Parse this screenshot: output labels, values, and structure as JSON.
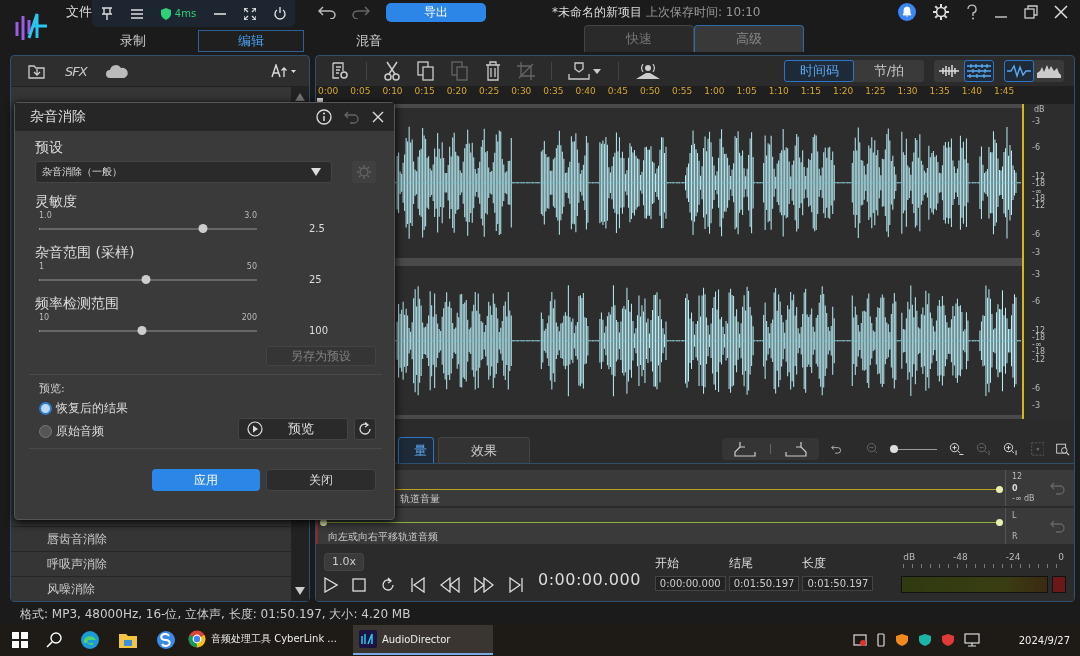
{
  "app": {
    "menu": "文件",
    "export": "导出",
    "title": "*未命名的新项目",
    "save_info": "上次保存时间: 10:10"
  },
  "overlay": {
    "latency": "4ms"
  },
  "mode_tabs": [
    {
      "label": "录制",
      "selected": false
    },
    {
      "label": "编辑",
      "selected": true
    },
    {
      "label": "混音",
      "selected": false
    }
  ],
  "view_tabs": [
    {
      "label": "快速",
      "selected": false
    },
    {
      "label": "高级",
      "selected": true
    }
  ],
  "left_panel": {
    "sfx": "SFX",
    "items": [
      "唇齿音消除",
      "呼吸声消除",
      "风噪消除"
    ]
  },
  "dialog": {
    "title": "杂音消除",
    "preset_label": "预设",
    "preset": "杂音消除（一般）",
    "sliders": [
      {
        "label": "灵敏度",
        "min": "1.0",
        "max": "3.0",
        "value": "2.5",
        "level": 0.75
      },
      {
        "label": "杂音范围 (采样)",
        "min": "1",
        "max": "50",
        "value": "25",
        "level": 0.49
      },
      {
        "label": "频率检测范围",
        "min": "10",
        "max": "200",
        "value": "100",
        "level": 0.47
      }
    ],
    "save_preset": "另存为预设",
    "preview_label": "预览:",
    "options": [
      {
        "label": "恢复后的结果",
        "selected": true
      },
      {
        "label": "原始音频",
        "selected": false
      }
    ],
    "preview_button": "预览",
    "apply": "应用",
    "close": "关闭"
  },
  "editor": {
    "time_modes": [
      {
        "label": "时间码",
        "selected": true
      },
      {
        "label": "节/拍",
        "selected": false
      }
    ],
    "ruler": [
      "0:00",
      "0:05",
      "0:10",
      "0:15",
      "0:20",
      "0:25",
      "0:30",
      "0:35",
      "0:40",
      "0:45",
      "0:50",
      "0:55",
      "1:00",
      "1:05",
      "1:10",
      "1:15",
      "1:20",
      "1:25",
      "1:30",
      "1:35",
      "1:40",
      "1:45"
    ],
    "db_unit": "dB",
    "channels": [
      {
        "db_scale": [
          "-3",
          "-6",
          "-12",
          "-18",
          "-∞",
          "-18",
          "-12",
          "-6",
          "-3"
        ]
      },
      {
        "db_scale": [
          "-3",
          "-6",
          "-12",
          "-18",
          "-∞",
          "-18",
          "-12",
          "-6",
          "-3"
        ]
      }
    ],
    "tabs": [
      {
        "label": "量",
        "selected": true
      },
      {
        "label": "效果",
        "selected": false
      }
    ],
    "zoom_slider": {
      "level": 0.03
    },
    "volume_lane": {
      "label": "轨道音量",
      "scale": [
        "12",
        "0",
        "-∞",
        "dB"
      ]
    },
    "pan_lane": {
      "label": "向左或向右平移轨道音频",
      "scale": [
        "L",
        "R"
      ]
    },
    "speed": "1.0x",
    "time": "0:00:00.000",
    "fields": [
      {
        "label": "开始",
        "value": "0:00:00.000"
      },
      {
        "label": "结尾",
        "value": "0:01:50.197"
      },
      {
        "label": "长度",
        "value": "0:01:50.197"
      }
    ],
    "meter_scale": [
      "dB",
      "-48",
      "-24",
      "0"
    ]
  },
  "status_bar": "格式: MP3, 48000Hz, 16-位, 立体声, 长度: 01:50.197, 大小: 4.20 MB",
  "taskbar": {
    "windows": [
      {
        "label": "音频处理工具 CyberLink ...",
        "selected": false
      },
      {
        "label": "AudioDirector",
        "selected": true
      }
    ],
    "date": "2024/9/27"
  }
}
